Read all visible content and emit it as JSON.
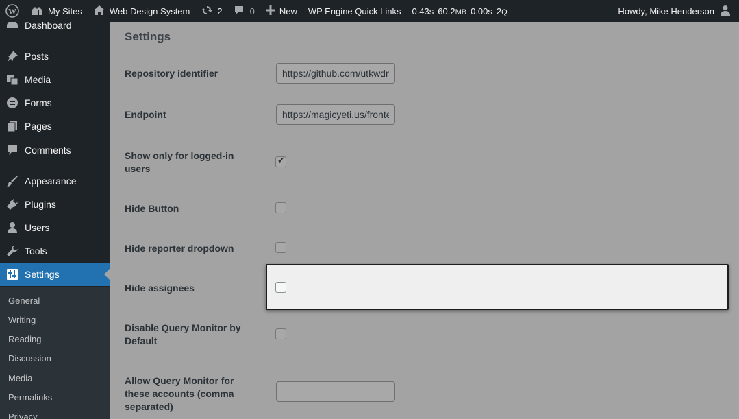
{
  "adminbar": {
    "my_sites": "My Sites",
    "site_name": "Web Design System",
    "updates_count": "2",
    "comments_count": "0",
    "new_label": "New",
    "wp_engine": "WP Engine Quick Links",
    "qm_time": "0.43s",
    "qm_mem": "60.2",
    "qm_mem_unit": "MB",
    "qm_db_time": "0.00s",
    "qm_queries": "2",
    "qm_queries_unit": "Q",
    "howdy": "Howdy, Mike Henderson"
  },
  "sidebar": {
    "items": [
      {
        "label": "Dashboard",
        "icon": "dashboard-icon"
      },
      {
        "label": "Posts",
        "icon": "pin-icon"
      },
      {
        "label": "Media",
        "icon": "media-icon"
      },
      {
        "label": "Forms",
        "icon": "forms-icon"
      },
      {
        "label": "Pages",
        "icon": "pages-icon"
      },
      {
        "label": "Comments",
        "icon": "comment-icon"
      },
      {
        "label": "Appearance",
        "icon": "brush-icon"
      },
      {
        "label": "Plugins",
        "icon": "plug-icon"
      },
      {
        "label": "Users",
        "icon": "user-icon"
      },
      {
        "label": "Tools",
        "icon": "wrench-icon"
      },
      {
        "label": "Settings",
        "icon": "settings-icon",
        "active": true
      }
    ],
    "submenu": [
      "General",
      "Writing",
      "Reading",
      "Discussion",
      "Media",
      "Permalinks",
      "Privacy"
    ]
  },
  "main": {
    "heading": "Settings",
    "fields": {
      "repo_label": "Repository identifier",
      "repo_value": "https://github.com/utkwdn/",
      "endpoint_label": "Endpoint",
      "endpoint_value": "https://magicyeti.us/frontend",
      "logged_in_label": "Show only for logged-in users",
      "logged_in_checked": true,
      "hide_button_label": "Hide Button",
      "hide_reporter_label": "Hide reporter dropdown",
      "hide_assignees_label": "Hide assignees",
      "disable_qm_label": "Disable Query Monitor by Default",
      "allow_qm_label": "Allow Query Monitor for these accounts (comma separated)",
      "allow_qm_value": ""
    }
  }
}
